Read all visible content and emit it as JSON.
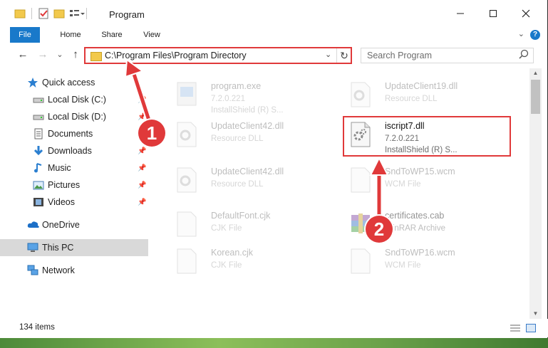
{
  "window": {
    "title": "Program",
    "controls": {
      "minimize": "—",
      "maximize": "☐",
      "close": "✕"
    }
  },
  "ribbon": {
    "tabs": [
      "File",
      "Home",
      "Share",
      "View"
    ],
    "help": "?"
  },
  "nav": {
    "back": "←",
    "forward": "→",
    "recent": "⌄",
    "up": "↑",
    "address": "C:\\Program Files\\Program Directory",
    "search_placeholder": "Search Program"
  },
  "sidebar": {
    "items": [
      {
        "label": "Quick access",
        "icon": "star-icon"
      },
      {
        "label": "Local Disk (C:)",
        "icon": "drive-icon"
      },
      {
        "label": "Local Disk (D:)",
        "icon": "drive-icon"
      },
      {
        "label": "Documents",
        "icon": "documents-icon"
      },
      {
        "label": "Downloads",
        "icon": "download-icon"
      },
      {
        "label": "Music",
        "icon": "music-icon"
      },
      {
        "label": "Pictures",
        "icon": "pictures-icon"
      },
      {
        "label": "Videos",
        "icon": "videos-icon"
      },
      {
        "label": "OneDrive",
        "icon": "cloud-icon"
      },
      {
        "label": "This PC",
        "icon": "computer-icon"
      },
      {
        "label": "Network",
        "icon": "network-icon"
      }
    ]
  },
  "files": [
    {
      "name": "program.exe",
      "line2": "7.2.0.221",
      "line3": "InstallShield (R) S...",
      "icon": "exe-icon"
    },
    {
      "name": "UpdateClient19.dll",
      "line2": "Resource DLL",
      "line3": "",
      "icon": "dll-icon"
    },
    {
      "name": "UpdateClient42.dll",
      "line2": "Resource DLL",
      "line3": "",
      "icon": "dll-icon"
    },
    {
      "name": "iscript7.dll",
      "line2": "7.2.0.221",
      "line3": "InstallShield (R) S...",
      "icon": "dll-icon"
    },
    {
      "name": "UpdateClient42.dll",
      "line2": "Resource DLL",
      "line3": "",
      "icon": "dll-icon"
    },
    {
      "name": "SndToWP15.wcm",
      "line2": "WCM File",
      "line3": "",
      "icon": "file-icon"
    },
    {
      "name": "DefaultFont.cjk",
      "line2": "CJK File",
      "line3": "",
      "icon": "file-icon"
    },
    {
      "name": "certificates.cab",
      "line2": "WinRAR Archive",
      "line3": "",
      "icon": "archive-icon"
    },
    {
      "name": "Korean.cjk",
      "line2": "CJK File",
      "line3": "",
      "icon": "file-icon"
    },
    {
      "name": "SndToWP16.wcm",
      "line2": "WCM File",
      "line3": "",
      "icon": "file-icon"
    }
  ],
  "status": {
    "item_count": "134 items"
  },
  "annotations": {
    "callout1": "1",
    "callout2": "2"
  },
  "colors": {
    "accent": "#1979ca",
    "highlight": "#e0393a",
    "selected": "#d9d9d9"
  }
}
